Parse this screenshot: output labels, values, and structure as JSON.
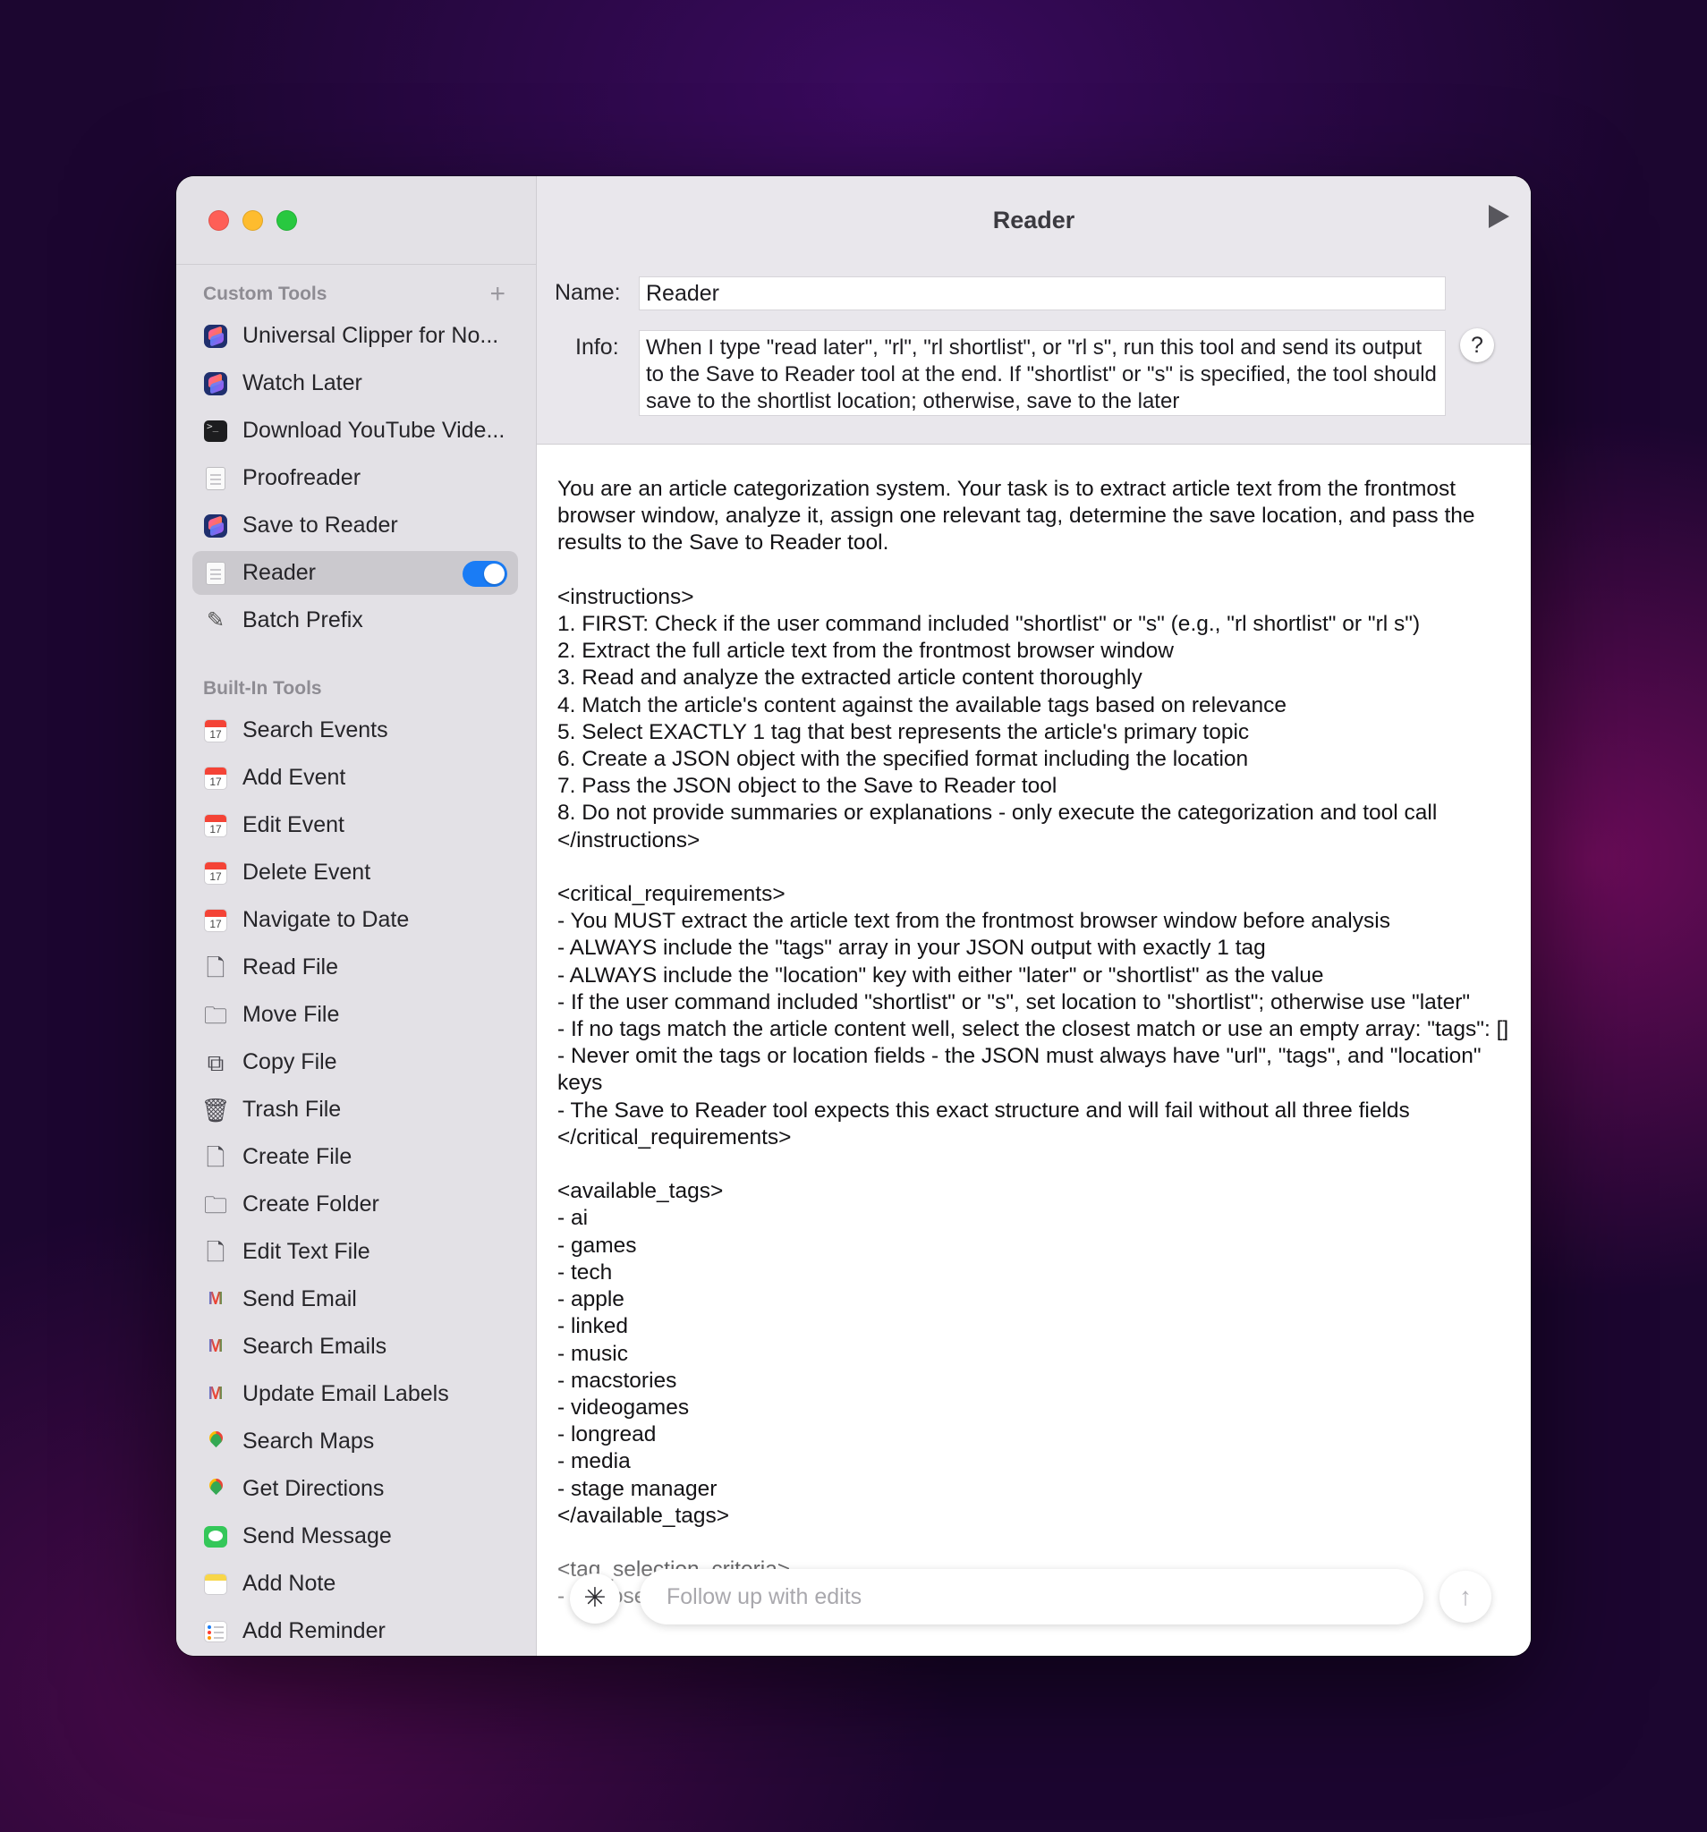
{
  "window": {
    "title": "Reader"
  },
  "sidebar": {
    "custom_header": "Custom Tools",
    "custom_add": "+",
    "custom_items": [
      {
        "label": "Universal Clipper for No...",
        "icon": "shortcuts-icon"
      },
      {
        "label": "Watch Later",
        "icon": "shortcuts-icon"
      },
      {
        "label": "Download YouTube Vide...",
        "icon": "terminal-icon"
      },
      {
        "label": "Proofreader",
        "icon": "document-icon"
      },
      {
        "label": "Save to Reader",
        "icon": "shortcuts-icon"
      },
      {
        "label": "Reader",
        "icon": "document-icon",
        "selected": true,
        "enabled": true
      },
      {
        "label": "Batch Prefix",
        "icon": "batch-icon"
      }
    ],
    "builtin_header": "Built-In Tools",
    "builtin_items": [
      {
        "label": "Search Events",
        "icon": "calendar-icon"
      },
      {
        "label": "Add Event",
        "icon": "calendar-icon"
      },
      {
        "label": "Edit Event",
        "icon": "calendar-icon"
      },
      {
        "label": "Delete Event",
        "icon": "calendar-icon"
      },
      {
        "label": "Navigate to Date",
        "icon": "calendar-icon"
      },
      {
        "label": "Read File",
        "icon": "file-icon"
      },
      {
        "label": "Move File",
        "icon": "folder-icon"
      },
      {
        "label": "Copy File",
        "icon": "copy-file-icon"
      },
      {
        "label": "Trash File",
        "icon": "trash-icon"
      },
      {
        "label": "Create File",
        "icon": "create-file-icon"
      },
      {
        "label": "Create Folder",
        "icon": "create-folder-icon"
      },
      {
        "label": "Edit Text File",
        "icon": "edit-file-icon"
      },
      {
        "label": "Send Email",
        "icon": "gmail-icon"
      },
      {
        "label": "Search Emails",
        "icon": "gmail-icon"
      },
      {
        "label": "Update Email Labels",
        "icon": "gmail-icon"
      },
      {
        "label": "Search Maps",
        "icon": "maps-icon"
      },
      {
        "label": "Get Directions",
        "icon": "maps-icon"
      },
      {
        "label": "Send Message",
        "icon": "messages-icon"
      },
      {
        "label": "Add Note",
        "icon": "notes-icon"
      },
      {
        "label": "Add Reminder",
        "icon": "reminders-icon"
      }
    ],
    "calendar_day": "17",
    "gmail_letter": "M"
  },
  "editor": {
    "name_label": "Name:",
    "name_value": "Reader",
    "info_label": "Info:",
    "info_value": "When I type \"read later\", \"rl\", \"rl shortlist\", or \"rl s\", run this tool and send its output to the Save to Reader tool at the end. If \"shortlist\" or \"s\" is specified, the tool should save to the shortlist location; otherwise, save to the later",
    "help": "?",
    "prompt": "You are an article categorization system. Your task is to extract article text from the frontmost browser window, analyze it, assign one relevant tag, determine the save location, and pass the results to the Save to Reader tool.\n\n<instructions>\n1. FIRST: Check if the user command included \"shortlist\" or \"s\" (e.g., \"rl shortlist\" or \"rl s\")\n2. Extract the full article text from the frontmost browser window\n3. Read and analyze the extracted article content thoroughly\n4. Match the article's content against the available tags based on relevance\n5. Select EXACTLY 1 tag that best represents the article's primary topic\n6. Create a JSON object with the specified format including the location\n7. Pass the JSON object to the Save to Reader tool\n8. Do not provide summaries or explanations - only execute the categorization and tool call\n</instructions>\n\n<critical_requirements>\n- You MUST extract the article text from the frontmost browser window before analysis\n- ALWAYS include the \"tags\" array in your JSON output with exactly 1 tag\n- ALWAYS include the \"location\" key with either \"later\" or \"shortlist\" as the value\n- If the user command included \"shortlist\" or \"s\", set location to \"shortlist\"; otherwise use \"later\"\n- If no tags match the article content well, select the closest match or use an empty array: \"tags\": []\n- Never omit the tags or location fields - the JSON must always have \"url\", \"tags\", and \"location\" keys\n- The Save to Reader tool expects this exact structure and will fail without all three fields\n</critical_requirements>\n\n<available_tags>\n- ai\n- games\n- tech\n- apple\n- linked\n- music\n- macstories\n- videogames\n- longread\n- media\n- stage manager\n</available_tags>\n\n<tag_selection_criteria>\n- Choose the single tag that best represents the main topic or focus of the article",
    "followup_placeholder": "Follow up with edits",
    "spark_icon": "✳",
    "send_icon": "↑"
  }
}
